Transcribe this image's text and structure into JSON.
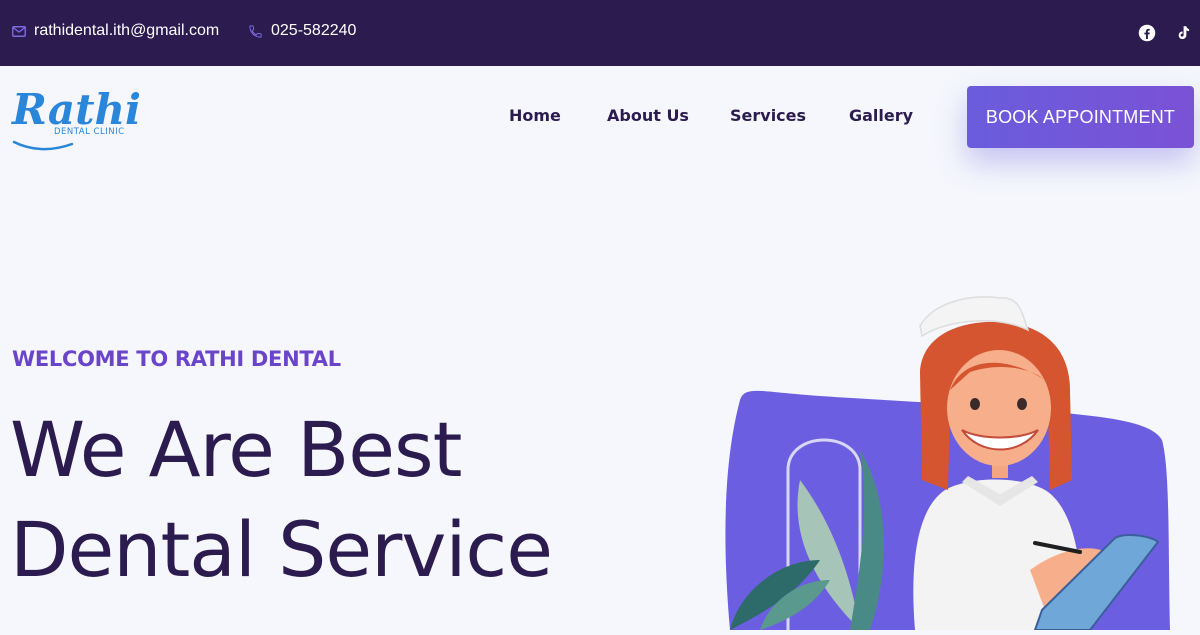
{
  "topbar": {
    "email": "rathidental.ith@gmail.com",
    "phone": "025-582240",
    "icons": [
      "mail-icon",
      "phone-icon",
      "facebook-icon",
      "tiktok-icon"
    ]
  },
  "logo": {
    "script_text": "Rathi",
    "sub_text": "DENTAL CLINIC"
  },
  "nav": {
    "items": [
      {
        "label": "Home"
      },
      {
        "label": "About Us"
      },
      {
        "label": "Services"
      },
      {
        "label": "Gallery"
      }
    ],
    "cta_label": "BOOK APPOINTMENT"
  },
  "hero": {
    "eyebrow": "WELCOME TO RATHI DENTAL",
    "title_line1": "We Are Best",
    "title_line2": "Dental Service"
  },
  "colors": {
    "topbar": "#2b1b4f",
    "accent": "#6a5cdc",
    "eyebrow": "#6b45c9",
    "heading": "#2b1b4f",
    "logo": "#2a86d9"
  }
}
